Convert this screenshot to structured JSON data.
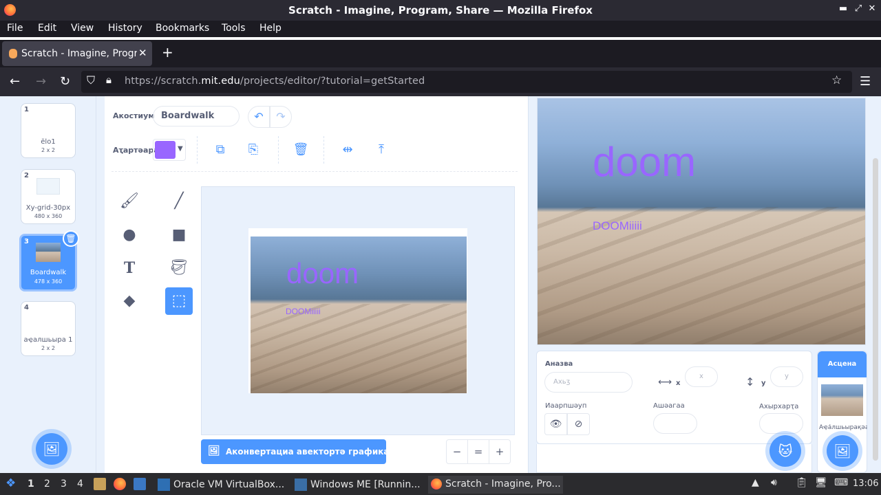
{
  "window": {
    "title": "Scratch - Imagine, Program, Share — Mozilla Firefox",
    "controls": [
      "▬",
      "⤢",
      "✕"
    ]
  },
  "menu": [
    "File",
    "Edit",
    "View",
    "History",
    "Bookmarks",
    "Tools",
    "Help"
  ],
  "tab": {
    "label": "Scratch - Imagine, Program, Share",
    "close": "✕",
    "new": "+"
  },
  "nav": {
    "url_prefix": "https://scratch.",
    "url_host": "mit.edu",
    "url_path": "/projects/editor/?tutorial=getStarted"
  },
  "costumes": [
    {
      "num": "1",
      "name": "ёlo1",
      "size": "2 x 2"
    },
    {
      "num": "2",
      "name": "Xy-grid-30px",
      "size": "480 x 360"
    },
    {
      "num": "3",
      "name": "Boardwalk",
      "size": "478 x 360"
    },
    {
      "num": "4",
      "name": "аҿалшьыра 1",
      "size": "2 x 2"
    }
  ],
  "editor": {
    "costume_label": "Акостиум",
    "costume_name": "Boardwalk",
    "fill_label": "Аҭартәара",
    "fill_color": "#9966ff",
    "convert_label": "Аконвертациа авектортә графика ахь",
    "zoom_out": "−",
    "zoom_reset": "=",
    "zoom_in": "+"
  },
  "canvas_text": {
    "big": "doom",
    "small": "DOOMiiiii"
  },
  "stage_text": {
    "big": "doom",
    "small": "DOOMiiiii"
  },
  "sprite_info": {
    "name_label": "Аназва",
    "name_placeholder": "Ахьӡ",
    "x_label": "x",
    "x_placeholder": "x",
    "y_label": "y",
    "y_placeholder": "y",
    "show_label": "Иаарпшәуп",
    "size_label": "Ашәагаа",
    "direction_label": "Ахырхарҭа"
  },
  "stage_pane": {
    "header": "Асцена",
    "backdrops_label": "Аҿа́лшьырақәа"
  },
  "taskbar": {
    "workspaces": [
      "1",
      "2",
      "3",
      "4"
    ],
    "tasks": [
      "Oracle VM VirtualBox...",
      "Windows ME [Runnin...",
      "Scratch - Imagine, Pro..."
    ],
    "clock": "13:06"
  },
  "colors": {
    "accent": "#4c97ff",
    "purple": "#9966ff",
    "panel": "#e9f1fc"
  }
}
